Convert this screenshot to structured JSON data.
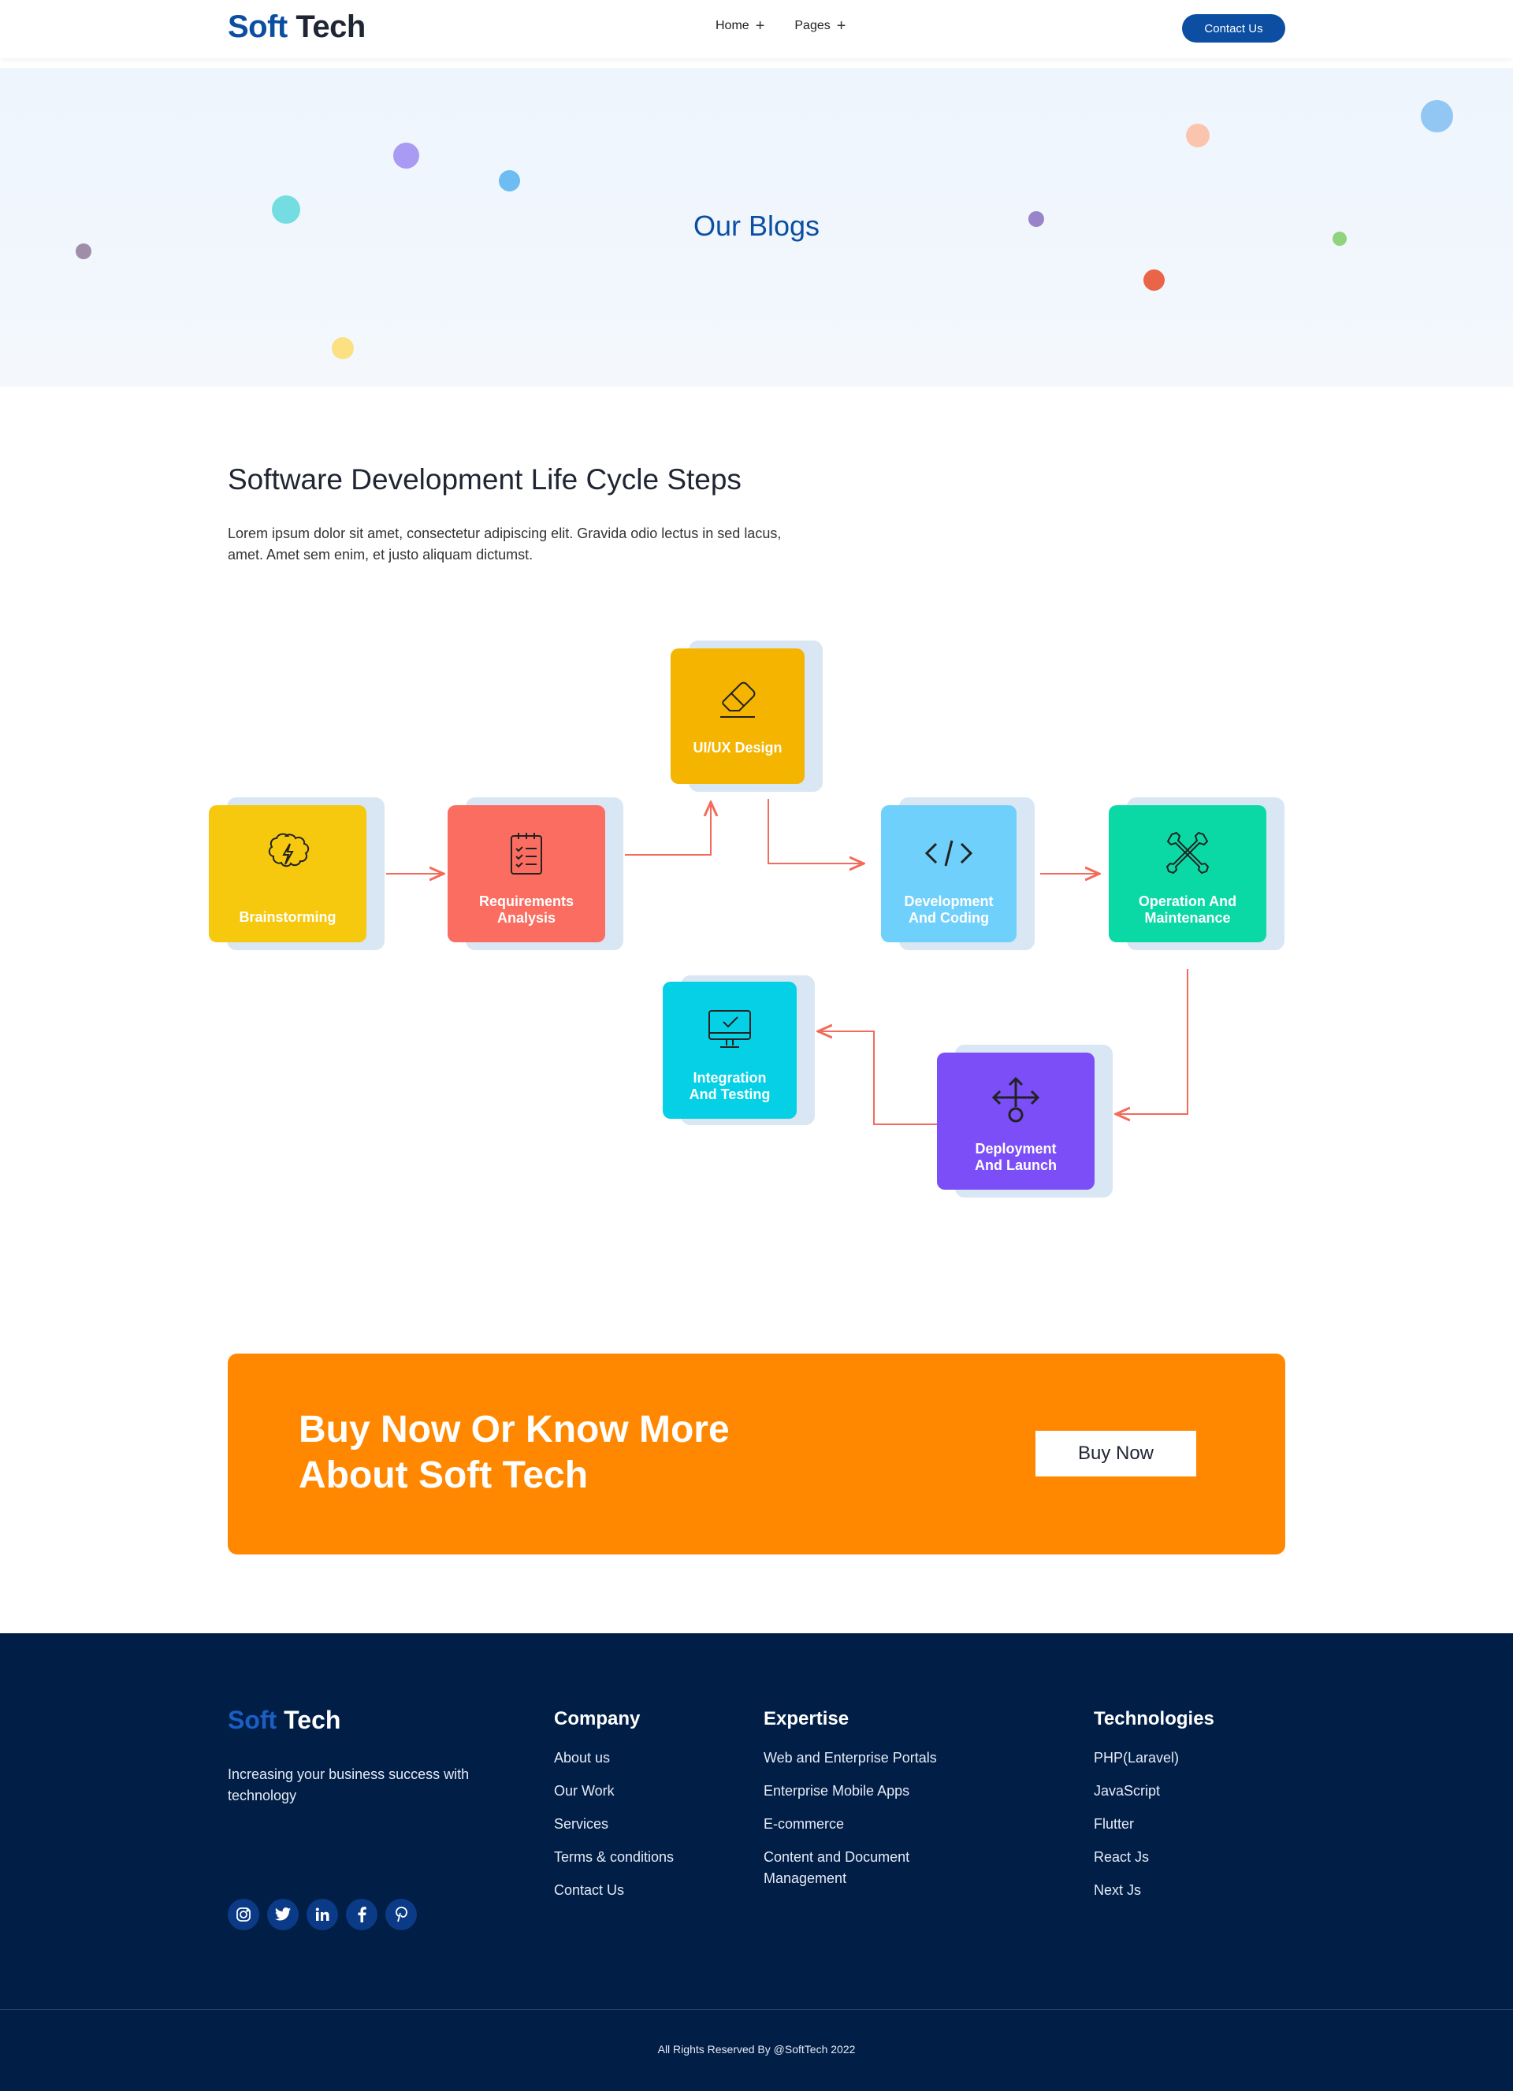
{
  "header": {
    "logo_part1": "Soft",
    "logo_part2": "Tech",
    "nav": [
      {
        "label": "Home"
      },
      {
        "label": "Pages"
      }
    ],
    "contact_label": "Contact Us"
  },
  "hero": {
    "title": "Our Blogs"
  },
  "section": {
    "title": "Software Development Life Cycle Steps",
    "text": "Lorem ipsum dolor sit amet, consectetur adipiscing elit. Gravida odio lectus in sed lacus, amet. Amet sem enim, et justo aliquam dictumst."
  },
  "steps": [
    {
      "label": "Brainstorming",
      "color": "#f6c90e",
      "icon": "brain-icon"
    },
    {
      "label": "Requirements Analysis",
      "color": "#fb6d60",
      "icon": "clipboard-icon"
    },
    {
      "label": "UI/UX Design",
      "color": "#f4b400",
      "icon": "eraser-icon"
    },
    {
      "label": "Development And Coding",
      "color": "#6fd0fb",
      "icon": "code-icon"
    },
    {
      "label": "Operation And Maintenance",
      "color": "#0ad9a6",
      "icon": "tools-icon"
    },
    {
      "label": "Deployment And Launch",
      "color": "#7b4ef7",
      "icon": "deploy-arrows-icon"
    },
    {
      "label": "Integration And Testing",
      "color": "#05d0e6",
      "icon": "monitor-check-icon"
    }
  ],
  "flow_colors": {
    "arrow": "#f26b5b",
    "card_shadow": "#d9e6f3"
  },
  "cta": {
    "title_line1": "Buy Now Or Know More",
    "title_line2": "About Soft Tech",
    "button_label": "Buy Now",
    "color": "#ff8800"
  },
  "footer": {
    "logo_part1": "Soft",
    "logo_part2": "Tech",
    "desc": "Increasing your business success with technology",
    "socials": [
      "instagram-icon",
      "twitter-icon",
      "linkedin-icon",
      "facebook-icon",
      "pinterest-icon"
    ],
    "company": {
      "title": "Company",
      "items": [
        "About us",
        "Our Work",
        "Services",
        "Terms & conditions",
        "Contact Us"
      ]
    },
    "expertise": {
      "title": "Expertise",
      "items": [
        "Web and Enterprise Portals",
        "Enterprise Mobile Apps",
        "E-commerce",
        "Content and Document Management"
      ]
    },
    "technologies": {
      "title": "Technologies",
      "items": [
        "PHP(Laravel)",
        "JavaScript",
        "Flutter",
        "React Js",
        "Next Js"
      ]
    },
    "copyright": "All Rights Reserved By @SoftTech 2022"
  },
  "colors": {
    "brand_blue": "#0b4ea2",
    "footer_bg": "#011e46",
    "hero_bg": "#eef5fd"
  }
}
